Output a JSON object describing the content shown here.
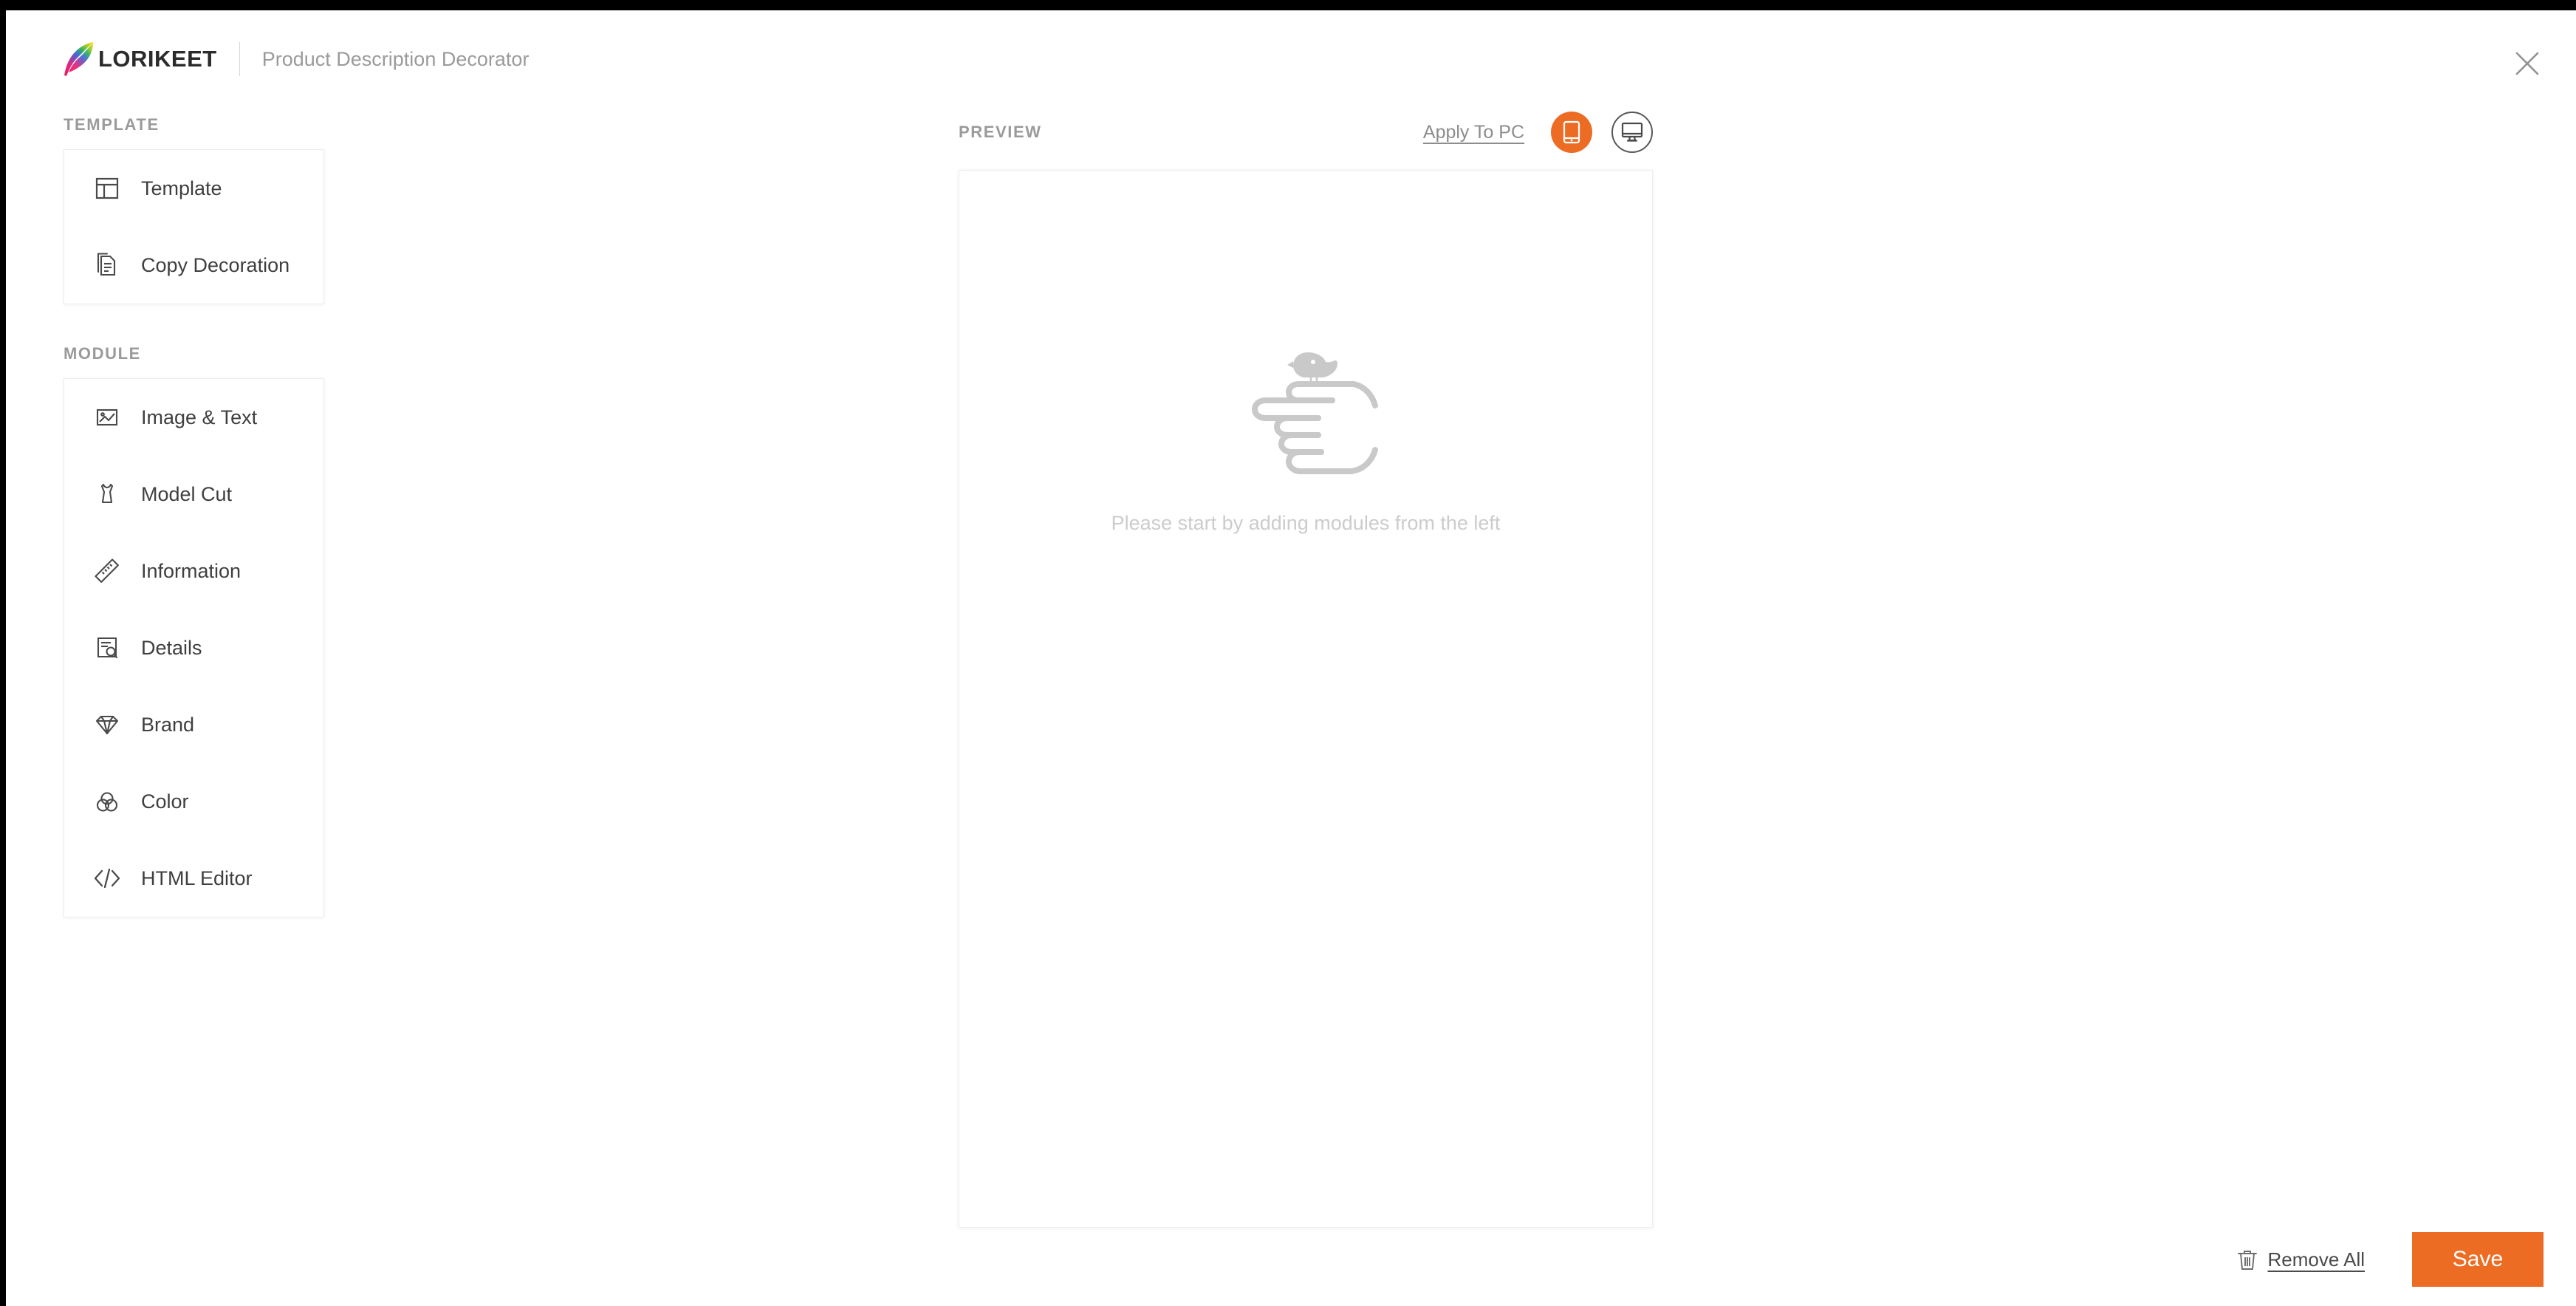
{
  "colors": {
    "accent": "#ed6c24",
    "logo_wordmark": "#2b2b2b",
    "subtitle": "#9b9b9b",
    "heading": "#9a9a9a",
    "item_label": "#3f3f3f",
    "empty_text": "#cccccc",
    "page_background": "#ffffff",
    "frame": "#000000"
  },
  "header": {
    "logo_text": "LORIKEET",
    "logo_icon": "feather-quill-icon",
    "subtitle": "Product Description Decorator",
    "close_icon": "close-icon"
  },
  "sidebar": {
    "template_section": {
      "heading": "TEMPLATE",
      "items": [
        {
          "label": "Template",
          "icon": "layout-template-icon"
        },
        {
          "label": "Copy Decoration",
          "icon": "copy-document-icon"
        }
      ]
    },
    "module_section": {
      "heading": "MODULE",
      "items": [
        {
          "label": "Image & Text",
          "icon": "image-picture-icon"
        },
        {
          "label": "Model Cut",
          "icon": "dress-garment-icon"
        },
        {
          "label": "Information",
          "icon": "ruler-icon"
        },
        {
          "label": "Details",
          "icon": "document-search-icon"
        },
        {
          "label": "Brand",
          "icon": "diamond-gem-icon"
        },
        {
          "label": "Color",
          "icon": "color-circles-icon"
        },
        {
          "label": "HTML Editor",
          "icon": "code-brackets-icon"
        }
      ]
    }
  },
  "preview": {
    "heading": "PREVIEW",
    "apply_to_pc_label": "Apply To PC",
    "device_toggles": [
      {
        "name": "mobile",
        "icon": "mobile-phone-icon",
        "active": true
      },
      {
        "name": "pc",
        "icon": "desktop-monitor-icon",
        "active": false
      }
    ],
    "empty_state": {
      "illustration": "hand-pointing-with-bird-icon",
      "message": "Please start by adding modules from the left"
    }
  },
  "footer": {
    "remove_all_label": "Remove All",
    "remove_all_icon": "trash-can-icon",
    "save_label": "Save"
  }
}
